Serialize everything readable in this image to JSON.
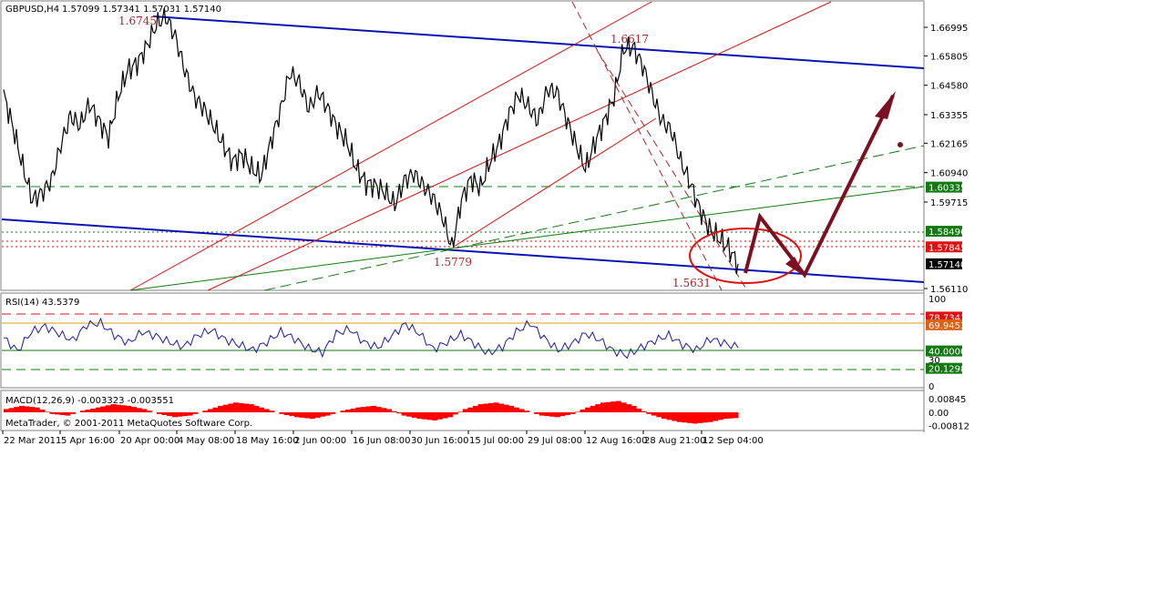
{
  "header": {
    "symbol": "GBPUSD,H4",
    "ohlc": "1.57099 1.57341 1.57031 1.57140"
  },
  "rsi_header": "RSI(14) 43.5379",
  "macd_header": "MACD(12,26,9) -0.003323 -0.003551",
  "watermark": "MetaTrader, © 2001-2011 MetaQuotes Software Corp.",
  "colors": {
    "price": "#000000",
    "channel_blue": "#0a14b4",
    "red_line": "#e01010",
    "green_line": "#117a11",
    "arrow": "#7a1020",
    "macd_hist": "#ff0000"
  },
  "chart_data": [
    {
      "type": "line",
      "panel": "price",
      "price_axis": [
        "1.66995",
        "1.65805",
        "1.64580",
        "1.63355",
        "1.62165",
        "1.60940",
        "1.59715",
        "1.56110"
      ],
      "time_axis": [
        "22 Mar 2011",
        "5 Apr 16:00",
        "20 Apr 00:00",
        "4 May 08:00",
        "18 May 16:00",
        "2 Jun 00:00",
        "16 Jun 08:00",
        "30 Jun 16:00",
        "15 Jul 00:00",
        "29 Jul 08:00",
        "12 Aug 16:00",
        "28 Aug 21:00",
        "12 Sep 04:00"
      ],
      "annotations": [
        "1.6745",
        "1.6617",
        "1.5779",
        "1.5631"
      ],
      "level_tags": [
        {
          "text": "1.60335",
          "color": "#117a11"
        },
        {
          "text": "1.58496",
          "color": "#117a11"
        },
        {
          "text": "1.57845",
          "color": "#e01010"
        },
        {
          "text": "1.57140",
          "color": "#000000"
        }
      ],
      "series": [
        {
          "values": [
            1.642,
            1.628,
            1.612,
            1.598,
            1.601,
            1.606,
            1.621,
            1.633,
            1.629,
            1.638,
            1.631,
            1.624,
            1.641,
            1.652,
            1.655,
            1.662,
            1.671,
            1.6745,
            1.666,
            1.652,
            1.641,
            1.636,
            1.629,
            1.621,
            1.614,
            1.617,
            1.611,
            1.608,
            1.622,
            1.635,
            1.651,
            1.647,
            1.636,
            1.643,
            1.636,
            1.628,
            1.622,
            1.611,
            1.605,
            1.604,
            1.601,
            1.596,
            1.606,
            1.609,
            1.604,
            1.599,
            1.591,
            1.5779,
            1.598,
            1.607,
            1.603,
            1.614,
            1.622,
            1.634,
            1.642,
            1.637,
            1.631,
            1.644,
            1.643,
            1.632,
            1.621,
            1.611,
            1.622,
            1.631,
            1.641,
            1.661,
            1.6617,
            1.654,
            1.642,
            1.631,
            1.627,
            1.614,
            1.605,
            1.594,
            1.586,
            1.582,
            1.578,
            1.5714
          ]
        }
      ]
    },
    {
      "type": "line",
      "panel": "rsi",
      "axis": [
        "100",
        "70",
        "30",
        "0"
      ],
      "level_tags": [
        {
          "text": "78.7341",
          "color": "#e01010"
        },
        {
          "text": "69.9453",
          "color": "#e06010"
        },
        {
          "text": "40.0000",
          "color": "#117a11"
        },
        {
          "text": "20.1298",
          "color": "#117a11"
        }
      ],
      "series": [
        {
          "name": "RSI(14)",
          "values": [
            55,
            40,
            62,
            68,
            60,
            52,
            70,
            72,
            58,
            49,
            62,
            57,
            50,
            45,
            58,
            64,
            53,
            47,
            41,
            50,
            62,
            54,
            43,
            38,
            60,
            65,
            50,
            44,
            57,
            71,
            60,
            42,
            50,
            59,
            48,
            37,
            45,
            62,
            72,
            55,
            41,
            48,
            60,
            53,
            40,
            35,
            44,
            52,
            58,
            47,
            41,
            54,
            49,
            43.5379
          ]
        }
      ]
    },
    {
      "type": "bar",
      "panel": "macd",
      "axis": [
        "0.00845",
        "0.00",
        "-0.00812"
      ],
      "series": [
        {
          "name": "MACD",
          "values": [
            0.002,
            0.004,
            0.003,
            -0.001,
            -0.002,
            0.001,
            0.003,
            0.005,
            0.004,
            0.002,
            -0.001,
            -0.003,
            -0.002,
            0.001,
            0.004,
            0.006,
            0.005,
            0.002,
            -0.001,
            -0.003,
            -0.004,
            -0.002,
            0.001,
            0.003,
            0.004,
            0.002,
            -0.002,
            -0.004,
            -0.005,
            -0.003,
            0.002,
            0.005,
            0.006,
            0.004,
            0.001,
            -0.002,
            -0.003,
            -0.001,
            0.003,
            0.006,
            0.007,
            0.004,
            -0.001,
            -0.004,
            -0.006,
            -0.007,
            -0.006,
            -0.004,
            -0.003323
          ]
        }
      ]
    }
  ]
}
